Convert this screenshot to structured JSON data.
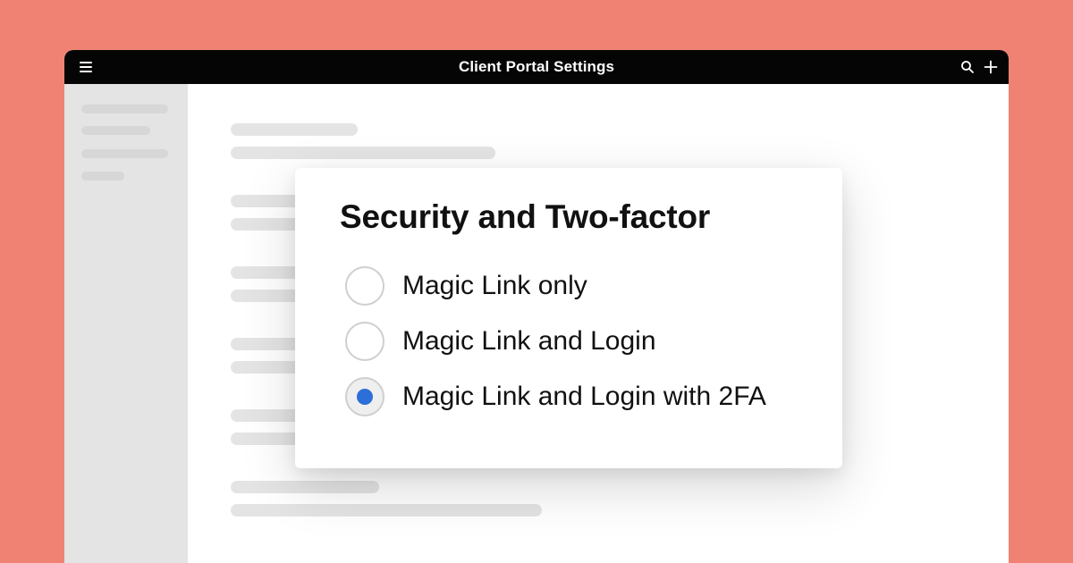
{
  "window": {
    "title": "Client Portal Settings"
  },
  "icons": {
    "menu": "hamburger-menu-icon",
    "search": "search-icon",
    "add": "plus-icon"
  },
  "dialog": {
    "title": "Security and Two-factor",
    "options": [
      {
        "label": "Magic Link only",
        "selected": false
      },
      {
        "label": "Magic Link and Login",
        "selected": false
      },
      {
        "label": "Magic Link and Login with 2FA",
        "selected": true
      }
    ]
  },
  "colors": {
    "background": "#f08274",
    "titlebar": "#050505",
    "sidebar": "#e4e4e4",
    "accent": "#2c6fd6"
  }
}
